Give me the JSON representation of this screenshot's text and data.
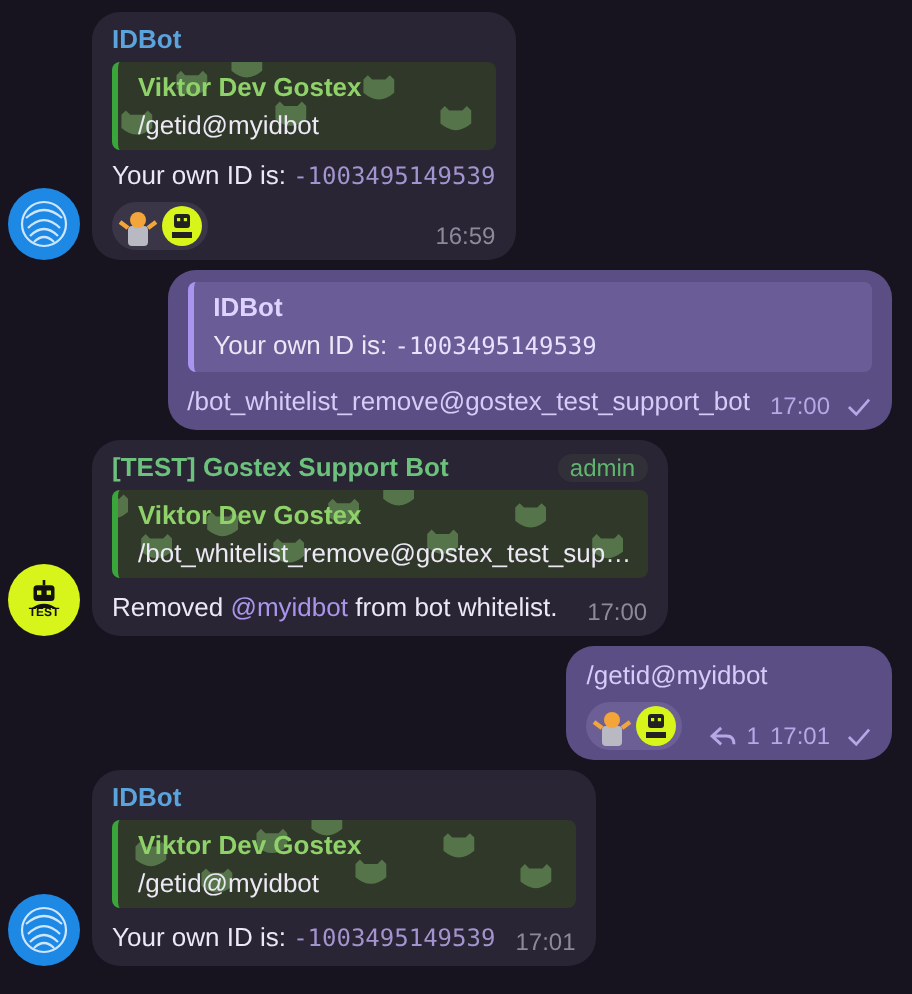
{
  "messages": [
    {
      "kind": "incoming",
      "avatar": {
        "kind": "fingerprint"
      },
      "sender": "IDBot",
      "color": "#5aa3dc",
      "reply": {
        "author": "Viktor Dev Gostex",
        "text": "/getid@myidbot"
      },
      "parts": [
        {
          "kind": "plain",
          "text": "Your own ID is: "
        },
        {
          "kind": "code",
          "text": "-1003495149539"
        }
      ],
      "reactions": [
        {
          "kind": "shrug"
        },
        {
          "kind": "robot"
        }
      ],
      "time": "16:59"
    },
    {
      "kind": "outgoing",
      "reply": {
        "author": "IDBot",
        "text_parts": [
          {
            "kind": "plain",
            "text": "Your own ID is: "
          },
          {
            "kind": "code",
            "text": "-1003495149539"
          }
        ]
      },
      "parts": [
        {
          "kind": "plain",
          "text": "/bot_whitelist_remove@gostex_test_support_bot"
        }
      ],
      "time": "17:00",
      "read": false
    },
    {
      "kind": "incoming",
      "avatar": {
        "kind": "robot",
        "label": "TEST"
      },
      "sender": "[TEST] Gostex Support Bot",
      "color": "#6cc27c",
      "badge": "admin",
      "reply": {
        "author": "Viktor Dev Gostex",
        "text": "/bot_whitelist_remove@gostex_test_sup…"
      },
      "parts": [
        {
          "kind": "plain",
          "text": "Removed "
        },
        {
          "kind": "mention",
          "text": "@myidbot"
        },
        {
          "kind": "plain",
          "text": " from bot whitelist."
        }
      ],
      "time": "17:00"
    },
    {
      "kind": "outgoing",
      "parts": [
        {
          "kind": "plain",
          "text": "/getid@myidbot"
        }
      ],
      "reactions": [
        {
          "kind": "shrug"
        },
        {
          "kind": "robot"
        }
      ],
      "replies": "1",
      "time": "17:01",
      "read": false
    },
    {
      "kind": "incoming",
      "avatar": {
        "kind": "fingerprint"
      },
      "sender": "IDBot",
      "color": "#5aa3dc",
      "reply": {
        "author": "Viktor Dev Gostex",
        "text": "/getid@myidbot"
      },
      "parts": [
        {
          "kind": "plain",
          "text": "Your own ID is: "
        },
        {
          "kind": "code",
          "text": "-1003495149539"
        }
      ],
      "time": "17:01"
    }
  ]
}
